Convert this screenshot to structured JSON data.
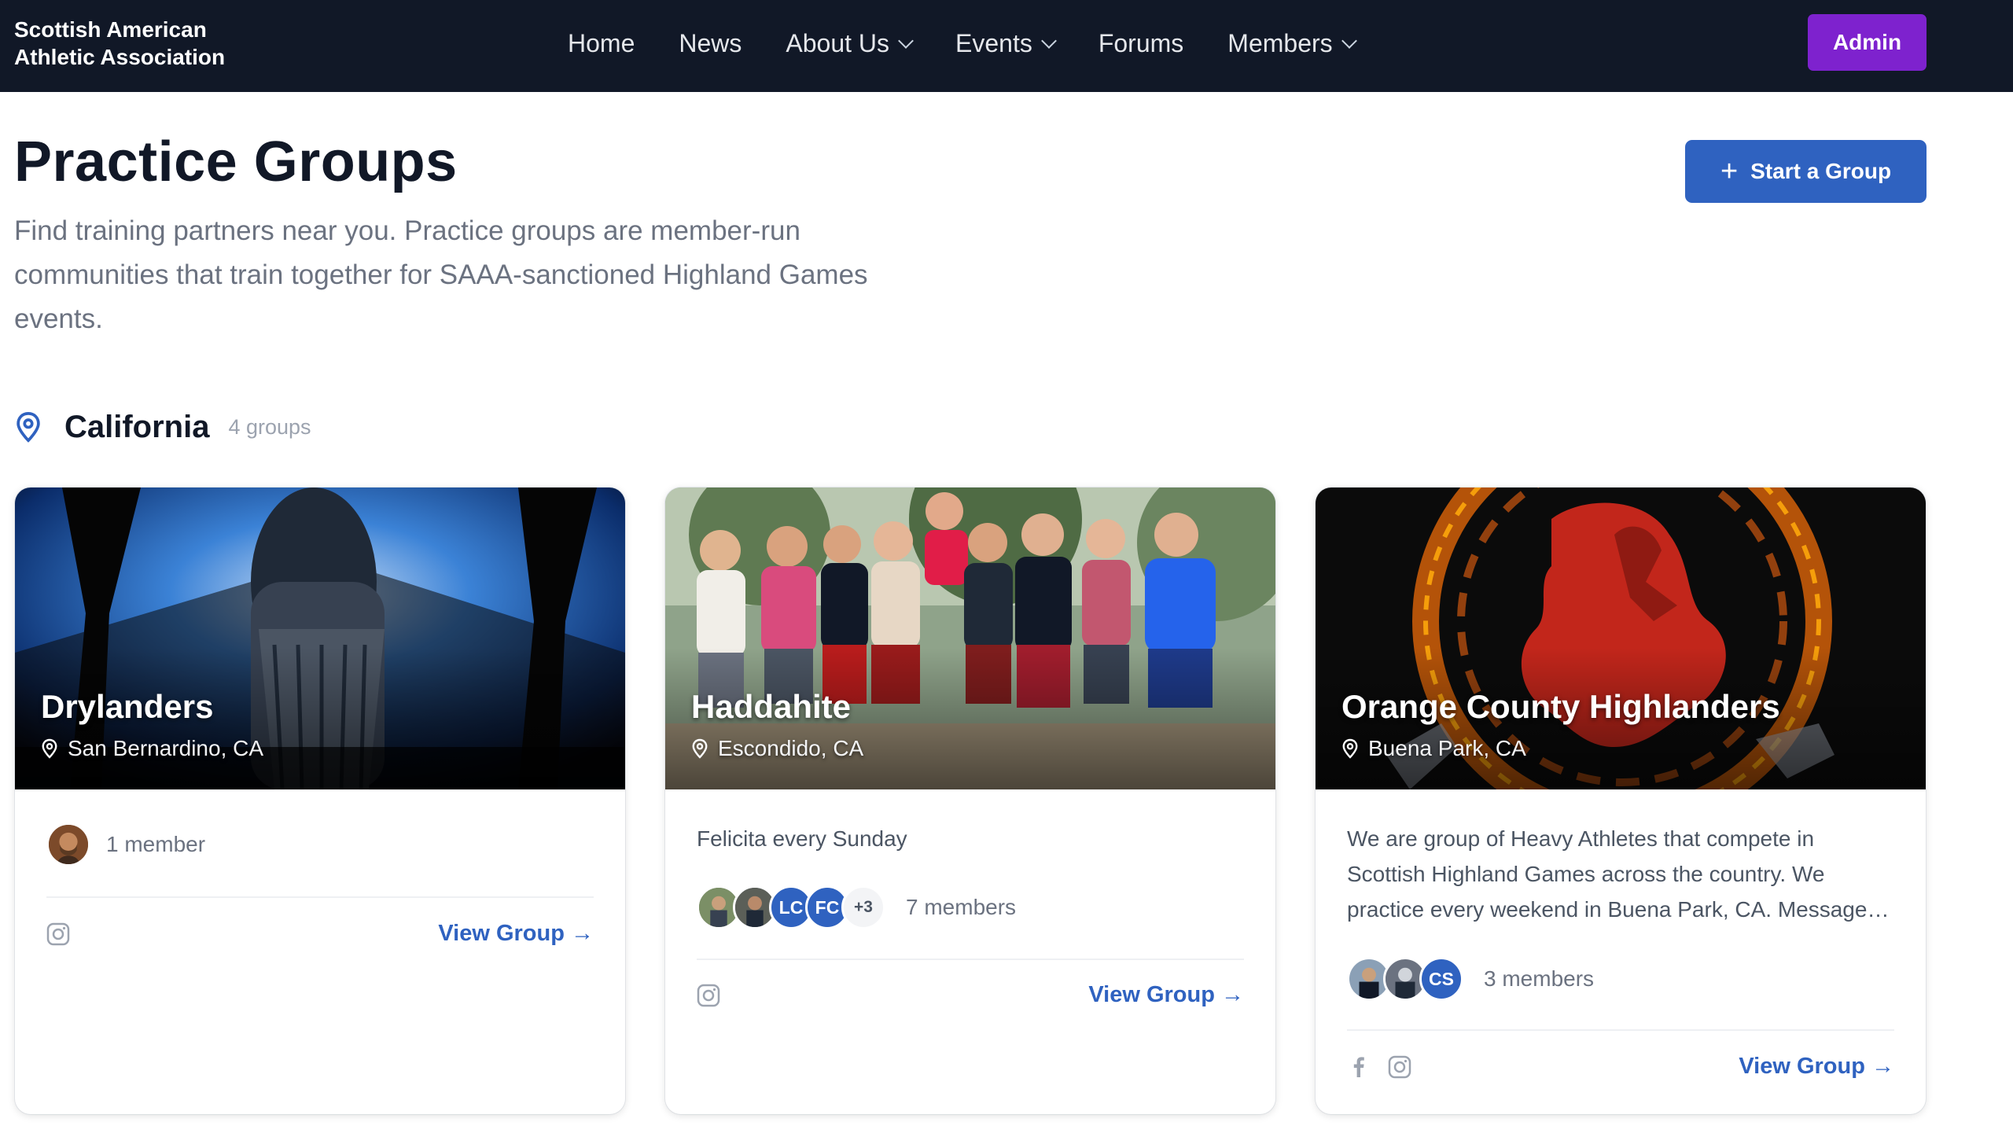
{
  "nav": {
    "brand_line1": "Scottish American",
    "brand_line2": "Athletic Association",
    "items": [
      {
        "label": "Home",
        "dropdown": false
      },
      {
        "label": "News",
        "dropdown": false
      },
      {
        "label": "About Us",
        "dropdown": true
      },
      {
        "label": "Events",
        "dropdown": true
      },
      {
        "label": "Forums",
        "dropdown": false
      },
      {
        "label": "Members",
        "dropdown": true
      }
    ],
    "admin_label": "Admin"
  },
  "header": {
    "title": "Practice Groups",
    "description": "Find training partners near you. Practice groups are member-run communities that train together for SAAA-sanctioned Highland Games events.",
    "start_button": "Start a Group"
  },
  "section": {
    "title": "California",
    "count": "4 groups"
  },
  "cards": [
    {
      "name": "Drylanders",
      "location": "San Bernardino, CA",
      "description": "",
      "avatars": [],
      "members_label": "1 member",
      "socials": [
        "instagram-icon"
      ],
      "link": "View Group →"
    },
    {
      "name": "Haddahite",
      "location": "Escondido, CA",
      "description": "Felicita every Sunday",
      "avatars": [
        "LC",
        "FC",
        "+3"
      ],
      "members_label": "7 members",
      "socials": [
        "instagram-icon"
      ],
      "link": "View Group →"
    },
    {
      "name": "Orange County Highlanders",
      "location": "Buena Park, CA",
      "description": "We are group of Heavy Athletes that compete in Scottish Highland Games across the country. We practice every weekend in Buena Park, CA. Message…",
      "avatars": [
        "CS"
      ],
      "members_label": "3 members",
      "socials": [
        "facebook-icon",
        "instagram-icon"
      ],
      "link": "View Group →"
    }
  ],
  "colors": {
    "navbar": "#111827",
    "admin": "#7e22ce",
    "accent": "#2f62c0",
    "muted": "#6b7280"
  }
}
